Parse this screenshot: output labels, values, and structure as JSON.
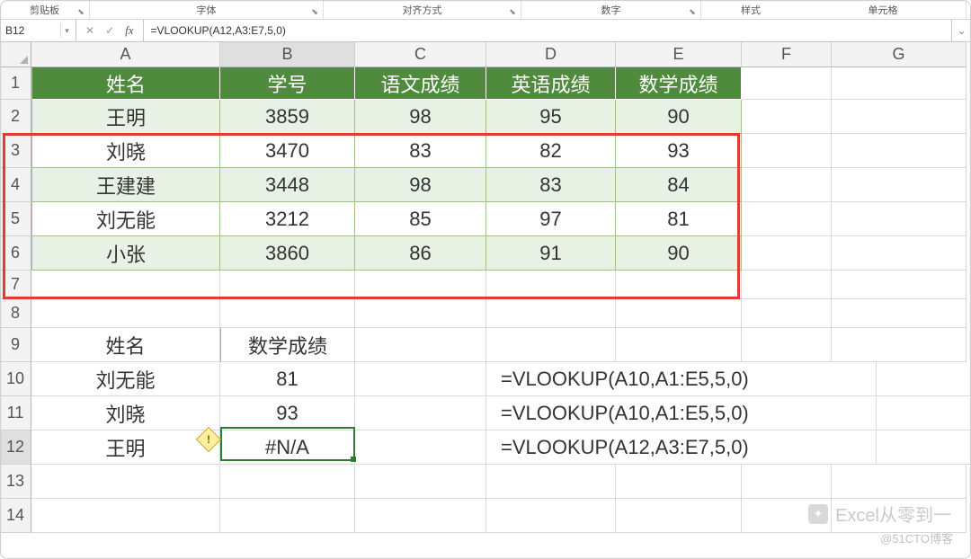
{
  "ribbon": {
    "groups": [
      "剪贴板",
      "字体",
      "对齐方式",
      "数字",
      "样式",
      "单元格"
    ]
  },
  "formula_bar": {
    "namebox": "B12",
    "cancel_glyph": "✕",
    "confirm_glyph": "✓",
    "fx_label": "fx",
    "formula": "=VLOOKUP(A12,A3:E7,5,0)"
  },
  "columns": [
    "A",
    "B",
    "C",
    "D",
    "E",
    "F",
    "G"
  ],
  "rows": [
    "1",
    "2",
    "3",
    "4",
    "5",
    "6",
    "7",
    "8",
    "9",
    "10",
    "11",
    "12",
    "13",
    "14"
  ],
  "table": {
    "headers": [
      "姓名",
      "学号",
      "语文成绩",
      "英语成绩",
      "数学成绩"
    ],
    "data": [
      {
        "name": "王明",
        "id": "3859",
        "c": "98",
        "e": "95",
        "m": "90"
      },
      {
        "name": "刘晓",
        "id": "3470",
        "c": "83",
        "e": "82",
        "m": "93"
      },
      {
        "name": "王建建",
        "id": "3448",
        "c": "98",
        "e": "83",
        "m": "84"
      },
      {
        "name": "刘无能",
        "id": "3212",
        "c": "85",
        "e": "97",
        "m": "81"
      },
      {
        "name": "小张",
        "id": "3860",
        "c": "86",
        "e": "91",
        "m": "90"
      }
    ]
  },
  "lookup": {
    "header_a": "姓名",
    "header_b": "数学成绩",
    "rows": [
      {
        "a": "刘无能",
        "b": "81",
        "f": "=VLOOKUP(A10,A1:E5,5,0)"
      },
      {
        "a": "刘晓",
        "b": "93",
        "f": "=VLOOKUP(A10,A1:E5,5,0)"
      },
      {
        "a": "王明",
        "b": "#N/A",
        "f": "=VLOOKUP(A12,A3:E7,5,0)"
      }
    ]
  },
  "watermark": {
    "line1": "Excel从零到一",
    "line2": "@51CTO博客"
  }
}
